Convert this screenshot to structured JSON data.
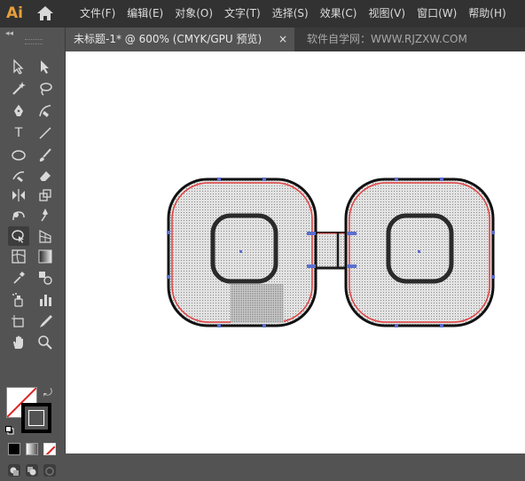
{
  "app": {
    "logo": "Ai"
  },
  "menu": [
    "文件(F)",
    "编辑(E)",
    "对象(O)",
    "文字(T)",
    "选择(S)",
    "效果(C)",
    "视图(V)",
    "窗口(W)",
    "帮助(H)"
  ],
  "toolbar": {
    "collapse": "◂◂",
    "type_tool_glyph": "T"
  },
  "tab": {
    "title": "未标题-1* @ 600% (CMYK/GPU 预览)",
    "close": "×"
  },
  "watermark": "软件自学网：WWW.RJZXW.COM",
  "colors": {
    "menubar_bg": "#323232",
    "panel_bg": "#535353",
    "canvas_bg": "#ffffff",
    "shape_fill": "#d4d4d4",
    "shape_stroke": "#1a1a1a",
    "selection_outline": "#e04040",
    "anchor_color": "#5a6fd0"
  }
}
